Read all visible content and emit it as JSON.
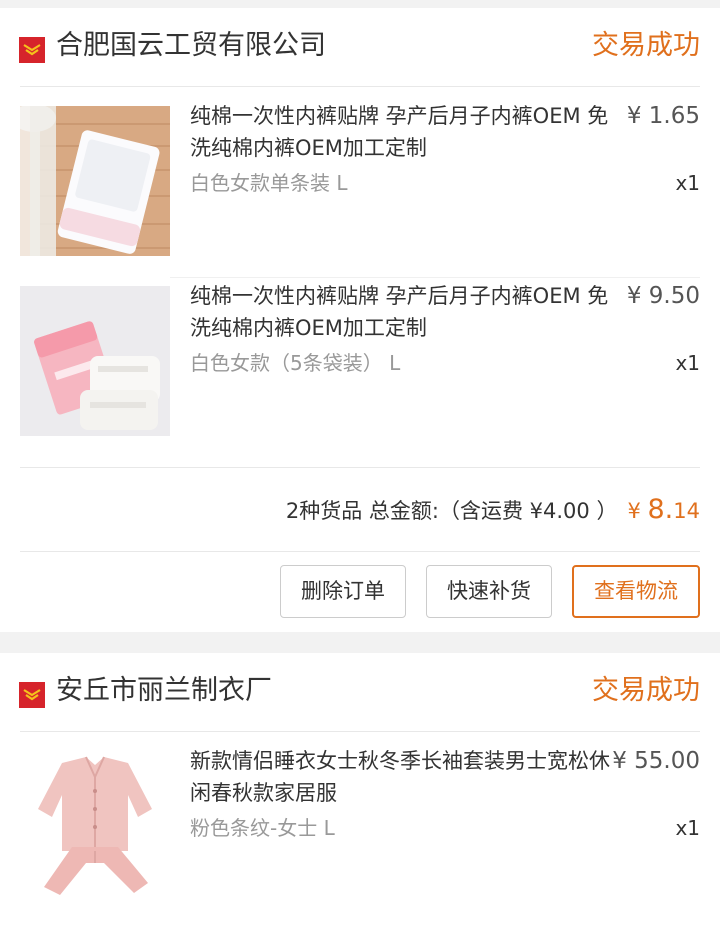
{
  "orders": [
    {
      "shop_name": "合肥国云工贸有限公司",
      "status": "交易成功",
      "items": [
        {
          "title": "纯棉一次性内裤贴牌 孕产后月子内裤OEM 免洗纯棉内裤OEM加工定制",
          "price": "¥ 1.65",
          "variant": "白色女款单条装 L",
          "quantity": "x1"
        },
        {
          "title": "纯棉一次性内裤贴牌 孕产后月子内裤OEM 免洗纯棉内裤OEM加工定制",
          "price": "¥ 9.50",
          "variant": "白色女款（5条袋装） L",
          "quantity": "x1"
        }
      ],
      "summary": {
        "label": "2种货品 总金额:（含运费 ¥4.00 ）",
        "total_currency": "¥ ",
        "total_integer": "8.",
        "total_decimal": "14"
      },
      "actions": {
        "delete_label": "删除订单",
        "restock_label": "快速补货",
        "logistics_label": "查看物流"
      }
    },
    {
      "shop_name": "安丘市丽兰制衣厂",
      "status": "交易成功",
      "items": [
        {
          "title": "新款情侣睡衣女士秋冬季长袖套装男士宽松休闲春秋款家居服",
          "price": "¥ 55.00",
          "variant": "粉色条纹-女士 L",
          "quantity": "x1"
        }
      ]
    }
  ],
  "icons": {
    "shop": "shop-icon",
    "accent_color": "#e0701d",
    "brand_red": "#d6242b"
  }
}
